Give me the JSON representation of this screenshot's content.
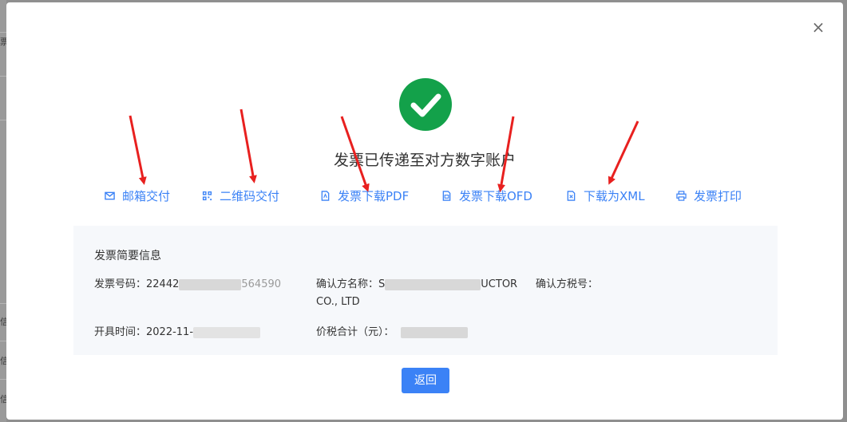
{
  "background": {
    "glyphs": [
      "票",
      "信",
      "信",
      "信"
    ]
  },
  "modal": {
    "close_symbol": "×",
    "result_title": "发票已传递至对方数字账户",
    "actions": [
      {
        "label": "邮箱交付",
        "icon": "mail-icon"
      },
      {
        "label": "二维码交付",
        "icon": "qrcode-icon"
      },
      {
        "label": "发票下载PDF",
        "icon": "pdf-file-icon"
      },
      {
        "label": "发票下载OFD",
        "icon": "ofd-file-icon"
      },
      {
        "label": "下载为XML",
        "icon": "xml-file-icon"
      },
      {
        "label": "发票打印",
        "icon": "printer-icon"
      }
    ],
    "info": {
      "title": "发票简要信息",
      "invoice_no_label": "发票号码：",
      "invoice_no_prefix": "22442",
      "invoice_no_suffix": "564590",
      "buyer_name_label": "确认方名称：",
      "buyer_name_prefix": "S",
      "buyer_name_suffix": "UCTOR",
      "buyer_name_line2": "CO., LTD",
      "buyer_tax_label": "确认方税号：",
      "issue_time_label": "开具时间：",
      "issue_time_prefix": "2022-11-",
      "total_label": "价税合计（元）："
    },
    "back_label": "返回"
  },
  "colors": {
    "accent": "#3b82f6",
    "success": "#13a14a",
    "annotation_arrow": "#e8201f"
  }
}
